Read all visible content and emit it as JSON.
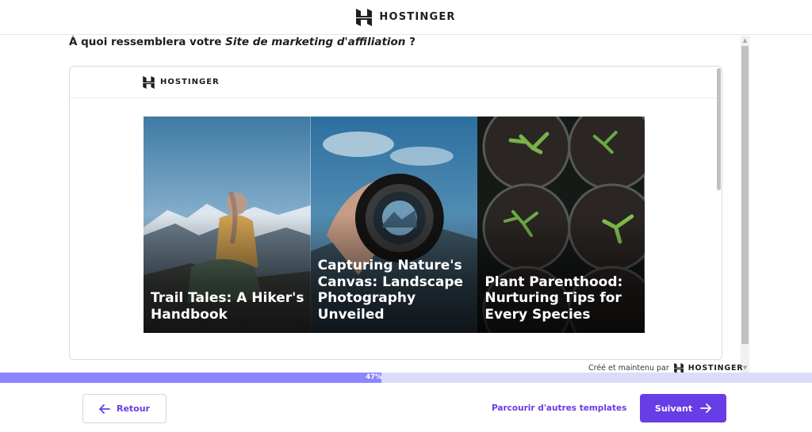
{
  "header": {
    "brand": "HOSTINGER"
  },
  "question": {
    "prefix": "À quoi ressemblera votre ",
    "site_type": "Site de marketing d'affiliation",
    "suffix": " ?"
  },
  "preview": {
    "brand": "HOSTINGER",
    "cards": [
      {
        "title": "Trail Tales: A Hiker's Handbook",
        "image": "hiker-mountain"
      },
      {
        "title": "Capturing Nature's Canvas: Landscape Photography Unveiled",
        "image": "camera-lens"
      },
      {
        "title": "Plant Parenthood: Nurturing Tips for Every Species",
        "image": "seedling-pots"
      }
    ]
  },
  "credit": {
    "text": "Créé et maintenu par",
    "brand": "HOSTINGER"
  },
  "progress": {
    "value": 47,
    "label": "47%"
  },
  "footer": {
    "back_label": "Retour",
    "browse_label": "Parcourir d'autres templates",
    "next_label": "Suivant"
  },
  "colors": {
    "accent": "#673de6",
    "progress_fill": "#8c85ff",
    "progress_track": "#dcdcfa"
  }
}
